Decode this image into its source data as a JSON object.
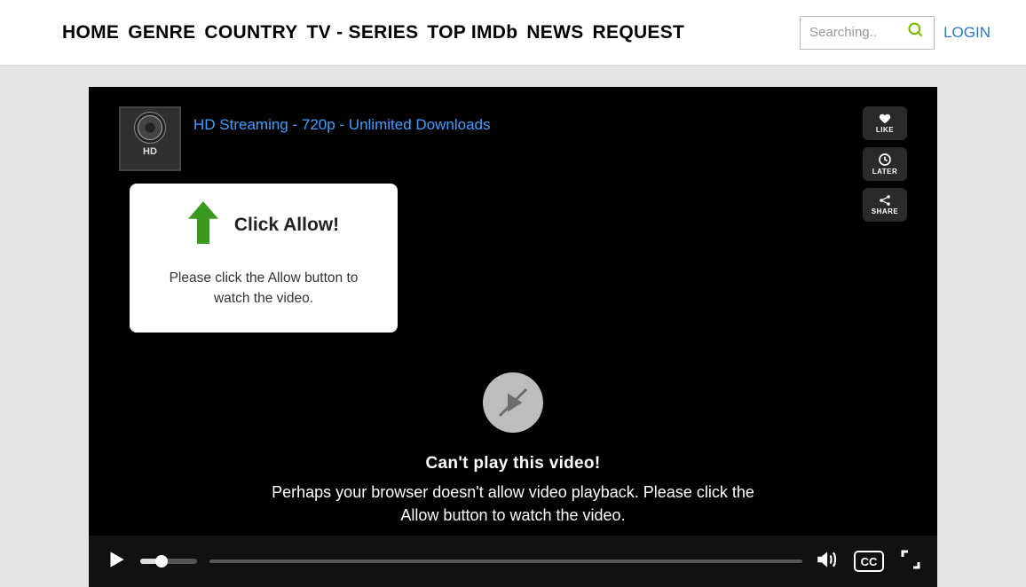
{
  "nav": {
    "items": [
      "HOME",
      "GENRE",
      "COUNTRY",
      "TV - SERIES",
      "TOP IMDb",
      "NEWS",
      "REQUEST"
    ]
  },
  "search": {
    "placeholder": "Searching.."
  },
  "login": "LOGIN",
  "banner": {
    "hd_badge": "HD",
    "link_text": "HD Streaming - 720p - Unlimited Downloads"
  },
  "actions": {
    "like": "LIKE",
    "later": "LATER",
    "share": "SHARE"
  },
  "popup": {
    "title": "Click Allow!",
    "body": "Please click the Allow button to watch the video."
  },
  "center": {
    "title": "Can't play this video!",
    "subtitle": "Perhaps your browser doesn't allow video playback. Please click the Allow button to watch the video."
  },
  "controls": {
    "cc": "CC"
  }
}
